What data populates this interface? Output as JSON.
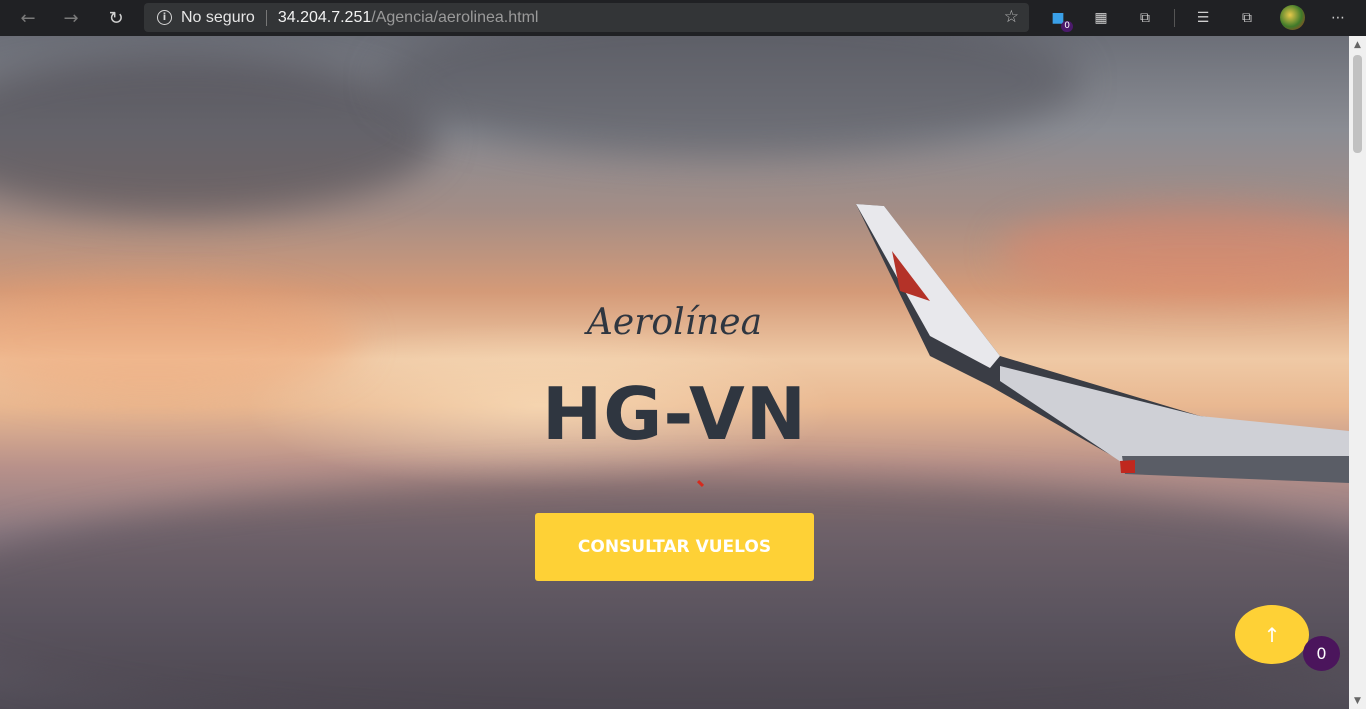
{
  "browser": {
    "back_icon": "arrow-left-icon",
    "forward_icon": "arrow-right-icon",
    "refresh_icon": "refresh-icon",
    "security_label": "No seguro",
    "url_host": "34.204.7.251",
    "url_path": "/Agencia/aerolinea.html",
    "extension_badge": "0"
  },
  "hero": {
    "subtitle": "Aerolínea",
    "title": "HG-VN",
    "cta_label": "CONSULTAR VUELOS"
  },
  "floating": {
    "counter": "0"
  },
  "colors": {
    "accent": "#fed136",
    "text_dark": "#2f3640",
    "badge": "#4b155c"
  }
}
